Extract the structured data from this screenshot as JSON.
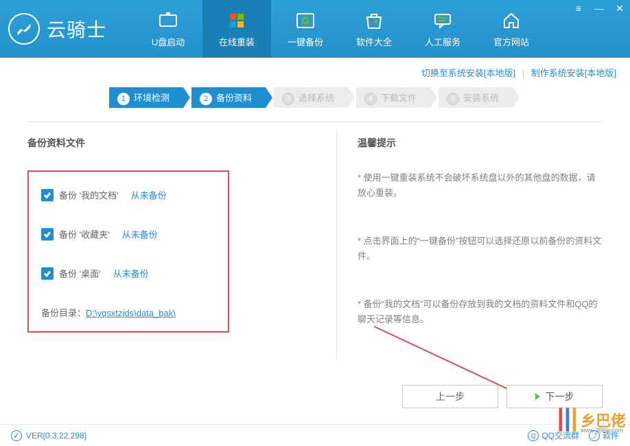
{
  "app": {
    "logo_text": "云骑士"
  },
  "nav": {
    "items": [
      {
        "label": "U盘启动"
      },
      {
        "label": "在线重装"
      },
      {
        "label": "一键备份"
      },
      {
        "label": "软件大全"
      },
      {
        "label": "人工服务"
      },
      {
        "label": "官方网站"
      }
    ]
  },
  "sub_links": {
    "switch": "切换至系统安装[本地版]",
    "make": "制作系统安装[本地版]"
  },
  "steps": [
    {
      "num": "1",
      "label": "环境检测"
    },
    {
      "num": "2",
      "label": "备份资料"
    },
    {
      "num": "3",
      "label": "选择系统"
    },
    {
      "num": "4",
      "label": "下载文件"
    },
    {
      "num": "5",
      "label": "安装系统"
    }
  ],
  "backup": {
    "title": "备份资料文件",
    "items": [
      {
        "label": "备份 '我的文档'",
        "status": "从未备份",
        "checked": true
      },
      {
        "label": "备份 '收藏夹'",
        "status": "从未备份",
        "checked": true
      },
      {
        "label": "备份 '桌面'",
        "status": "从未备份",
        "checked": true
      }
    ],
    "path_label": "备份目录：",
    "path": "D:\\yqsxtzjds\\data_bak\\"
  },
  "tips": {
    "title": "温馨提示",
    "items": [
      "* 使用一键重装系统不会破坏系统盘以外的其他盘的数据，请放心重装。",
      "* 点击界面上的“一键备份”按钮可以选择还原以前备份的资料文件。",
      "* 备份“我的文档”可以备份存放到我的文档的资料文件和QQ的聊天记录等信息。"
    ]
  },
  "buttons": {
    "prev": "上一步",
    "next": "下一步"
  },
  "footer": {
    "version": "VER[0.3.22.298]",
    "qq": "QQ交流群",
    "soft": "软件"
  },
  "watermark": {
    "text": "乡巴佬",
    "url": "www.386w.com"
  }
}
